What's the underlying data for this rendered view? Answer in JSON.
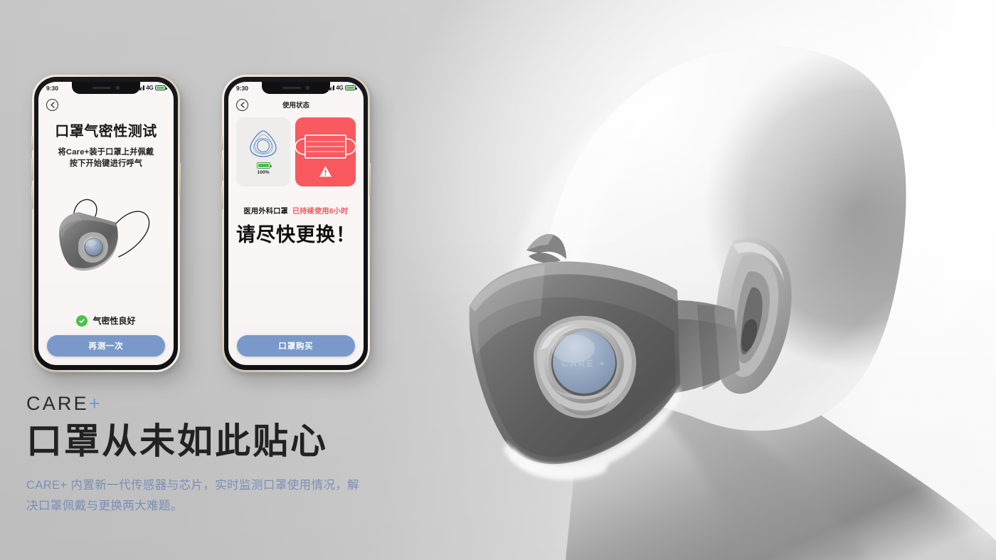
{
  "brand": {
    "name": "CARE",
    "plus": "+"
  },
  "headline": "口罩从未如此贴心",
  "body_copy": "CARE+ 内置新一代传感器与芯片，实时监测口罩使用情况，解决口罩佩戴与更换两大难题。",
  "product_engraving": "CARE +",
  "phone1": {
    "status_bar": {
      "time": "9:30",
      "network": "4G"
    },
    "nav_title": "",
    "title": "口罩气密性测试",
    "subtitle_line1": "将Care+装于口罩上并佩戴",
    "subtitle_line2": "按下开始键进行呼气",
    "result_text": "气密性良好",
    "cta_label": "再测一次",
    "icons": {
      "back": "chevron-left-icon",
      "result": "check-circle-icon",
      "battery": "battery-icon",
      "signal": "signal-bars-icon"
    },
    "colors": {
      "cta": "#7b9bcc",
      "check": "#4cc44c",
      "screen": "#faf6f5"
    }
  },
  "phone2": {
    "status_bar": {
      "time": "9:30",
      "network": "4G"
    },
    "nav_title": "使用状态",
    "device_card": {
      "battery_percent": "100%",
      "icon": "care-device-icon"
    },
    "alert_card": {
      "icon": "surgical-mask-icon",
      "warning_icon": "warning-triangle-icon"
    },
    "mask_kind": "医用外科口罩",
    "duration": "已持续使用8小时",
    "big_message": "请尽快更换！",
    "cta_label": "口罩购买",
    "colors": {
      "cta": "#7b9bcc",
      "alert": "#f9565c",
      "alert_text": "#f0565c",
      "device_card": "#efecec",
      "device_icon": "#4a7fc6",
      "battery": "#46bd4f"
    }
  },
  "theme": {
    "background_left": "#c3c3c3",
    "background_right": "#ffffff",
    "accent_blue": "#6f9bd8",
    "body_text_blue": "#7d93bd",
    "headline_color": "#232323"
  }
}
